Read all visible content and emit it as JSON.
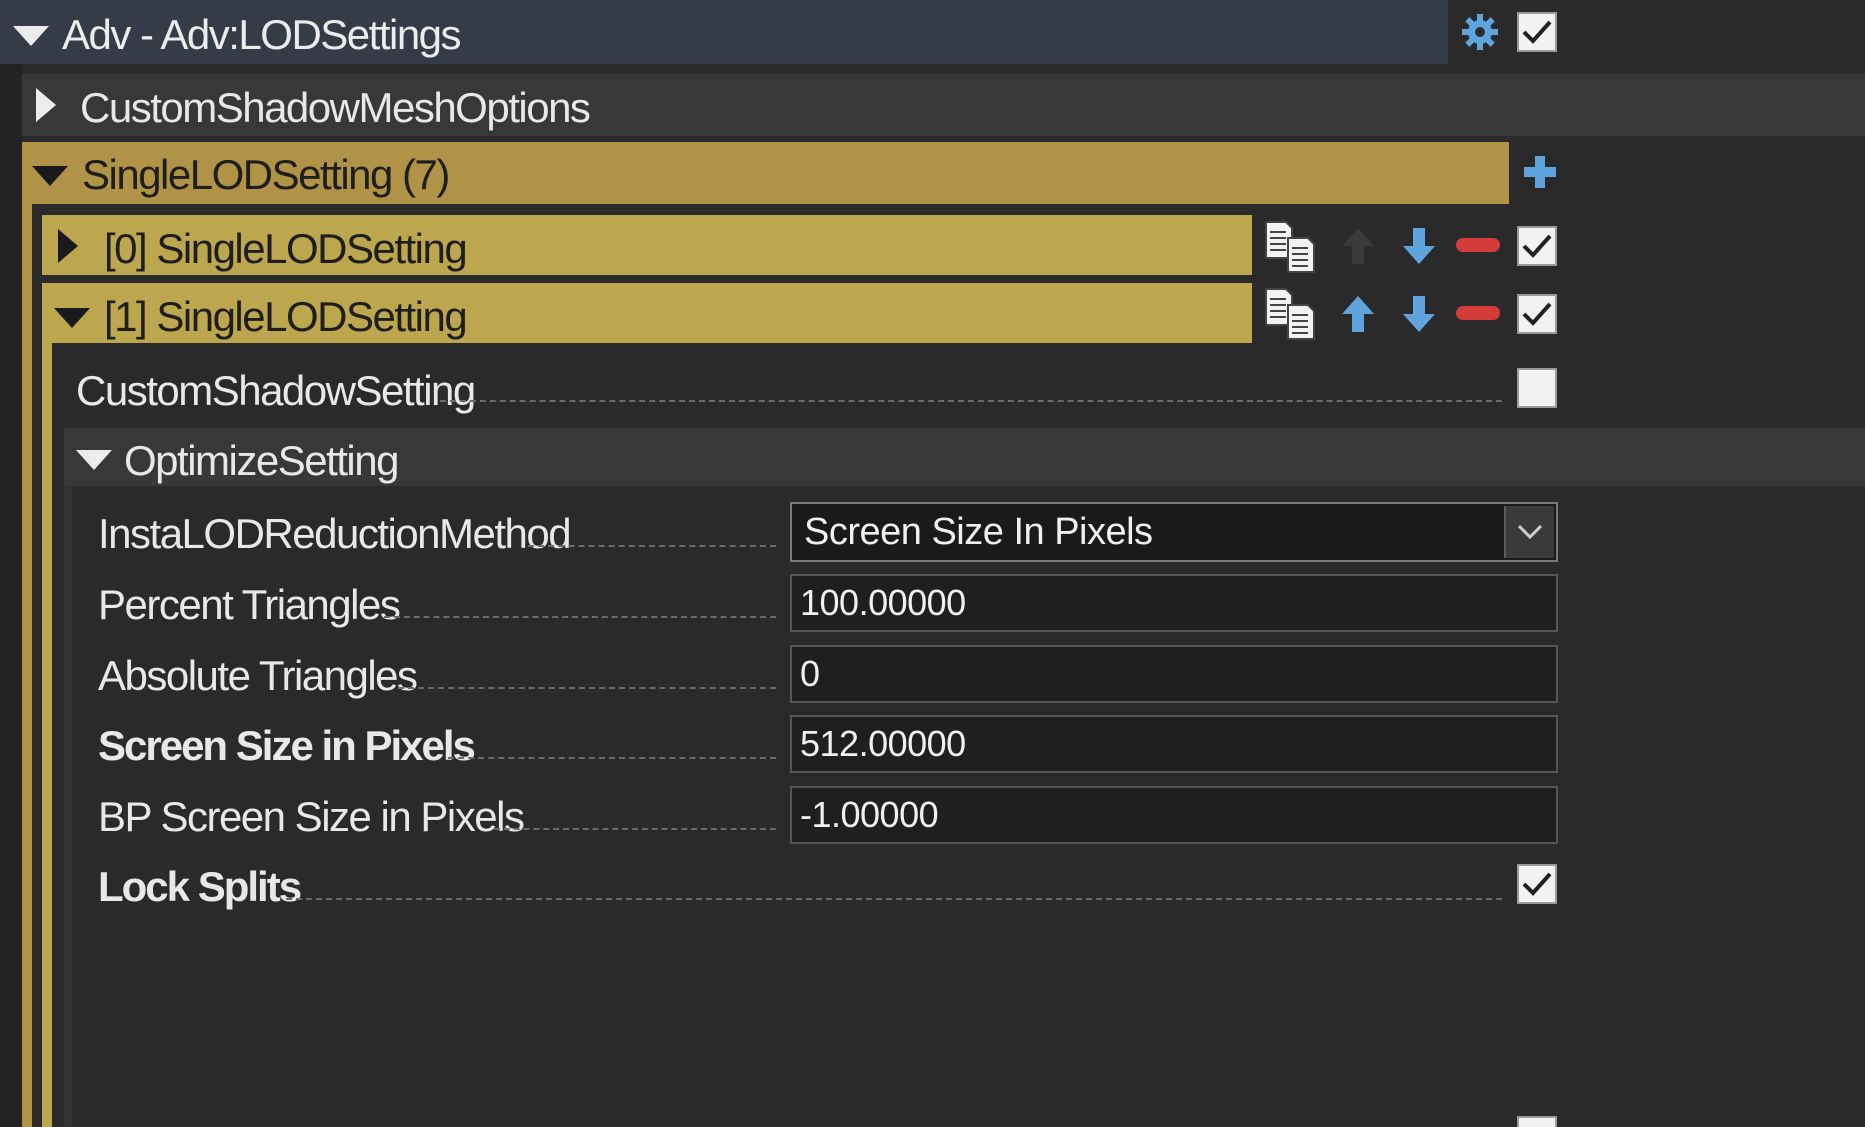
{
  "header": {
    "title": "Adv - Adv:LODSettings",
    "enabled": true
  },
  "sections": {
    "custom_shadow_mesh_options": "CustomShadowMeshOptions",
    "single_lod_setting_group": "SingleLODSetting (7)"
  },
  "lod_items": [
    {
      "label": "[0] SingleLODSetting",
      "expanded": false,
      "enabled": true
    },
    {
      "label": "[1] SingleLODSetting",
      "expanded": true,
      "enabled": true
    }
  ],
  "props": {
    "custom_shadow_setting": {
      "label": "CustomShadowSetting",
      "checked": false
    },
    "optimize_setting": "OptimizeSetting",
    "reduction_method": {
      "label": "InstaLODReductionMethod",
      "value": "Screen Size In Pixels"
    },
    "percent_triangles": {
      "label": "Percent Triangles",
      "value": "100.00000"
    },
    "absolute_triangles": {
      "label": "Absolute Triangles",
      "value": "0"
    },
    "screen_size": {
      "label": "Screen Size in Pixels",
      "value": "512.00000"
    },
    "bp_screen_size": {
      "label": "BP Screen Size in Pixels",
      "value": "-1.00000"
    },
    "lock_splits": {
      "label": "Lock Splits",
      "checked": true
    }
  },
  "icons": {
    "gear": "gear-icon",
    "add": "plus-icon",
    "copy": "copy-icon",
    "up": "arrow-up-icon",
    "down": "arrow-down-icon",
    "remove": "minus-icon"
  },
  "colors": {
    "header_bg": "#353c48",
    "group_bg": "#b09346",
    "item_bg": "#bca64e",
    "accent_blue": "#5fa4dc",
    "remove_red": "#d43b3b"
  }
}
